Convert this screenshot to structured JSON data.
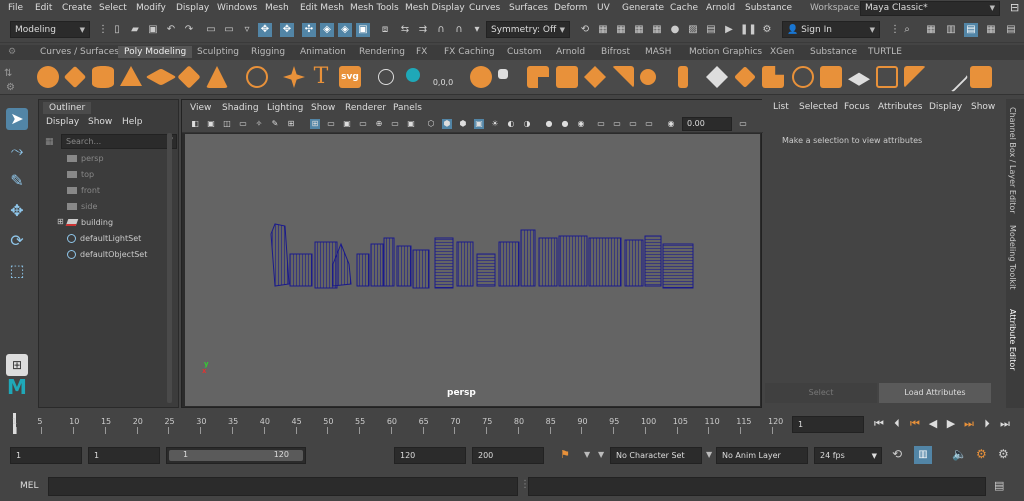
{
  "menubar": {
    "items": [
      "File",
      "Edit",
      "Create",
      "Select",
      "Modify",
      "Display",
      "Windows",
      "Mesh",
      "Edit Mesh",
      "Mesh Tools",
      "Mesh Display",
      "Curves",
      "Surfaces",
      "Deform",
      "UV",
      "Generate",
      "Cache",
      "Arnold",
      "Substance"
    ],
    "workspace_label": "Workspace :",
    "workspace_value": "Maya Classic*"
  },
  "statusline": {
    "menuset": "Modeling",
    "symmetry": "Symmetry: Off",
    "sign_in": "Sign In"
  },
  "shelf_tabs": [
    "Curves / Surfaces",
    "Poly Modeling",
    "Sculpting",
    "Rigging",
    "Animation",
    "Rendering",
    "FX",
    "FX Caching",
    "Custom",
    "Arnold",
    "Bifrost",
    "MASH",
    "Motion Graphics",
    "XGen",
    "Substance",
    "TURTLE"
  ],
  "shelf_active": "Poly Modeling",
  "shelf_text_icons": {
    "t": "T",
    "svg": "svg",
    "coords": "0,0,0"
  },
  "outliner": {
    "tab": "Outliner",
    "menu": [
      "Display",
      "Show",
      "Help"
    ],
    "search_placeholder": "Search...",
    "items": [
      {
        "label": "persp",
        "dim": true
      },
      {
        "label": "top",
        "dim": true
      },
      {
        "label": "front",
        "dim": true
      },
      {
        "label": "side",
        "dim": true
      },
      {
        "label": "building",
        "dim": false
      },
      {
        "label": "defaultLightSet",
        "dim": false
      },
      {
        "label": "defaultObjectSet",
        "dim": false
      }
    ]
  },
  "viewport": {
    "menu": [
      "View",
      "Shading",
      "Lighting",
      "Show",
      "Renderer",
      "Panels"
    ],
    "field_value": "0.00",
    "camera_label": "persp",
    "axis_x": "x",
    "axis_y": "y",
    "wire_color": "#1a1a8c"
  },
  "attribute_editor": {
    "menu": [
      "List",
      "Selected",
      "Focus",
      "Attributes",
      "Display",
      "Show"
    ],
    "message": "Make a selection to view attributes",
    "select_label": "Select",
    "load_label": "Load Attributes"
  },
  "side_tabs": [
    "Channel Box / Layer Editor",
    "Modeling Toolkit",
    "Attribute Editor"
  ],
  "timeslider": {
    "ticks": [
      "1",
      "5",
      "10",
      "15",
      "20",
      "25",
      "30",
      "35",
      "40",
      "45",
      "50",
      "55",
      "60",
      "65",
      "70",
      "75",
      "80",
      "85",
      "90",
      "95",
      "100",
      "105",
      "110",
      "115",
      "120"
    ],
    "current_frame": "1"
  },
  "range": {
    "start": "1",
    "anim_start": "1",
    "slider_start": "1",
    "slider_end": "120",
    "anim_end": "120",
    "end": "200",
    "character_set": "No Character Set",
    "anim_layer": "No Anim Layer",
    "fps": "24 fps"
  },
  "command": {
    "label": "MEL"
  },
  "colors": {
    "accent": "#5285a6",
    "shelf_orange": "#e8913a",
    "maya_teal": "#1fa8b8"
  }
}
